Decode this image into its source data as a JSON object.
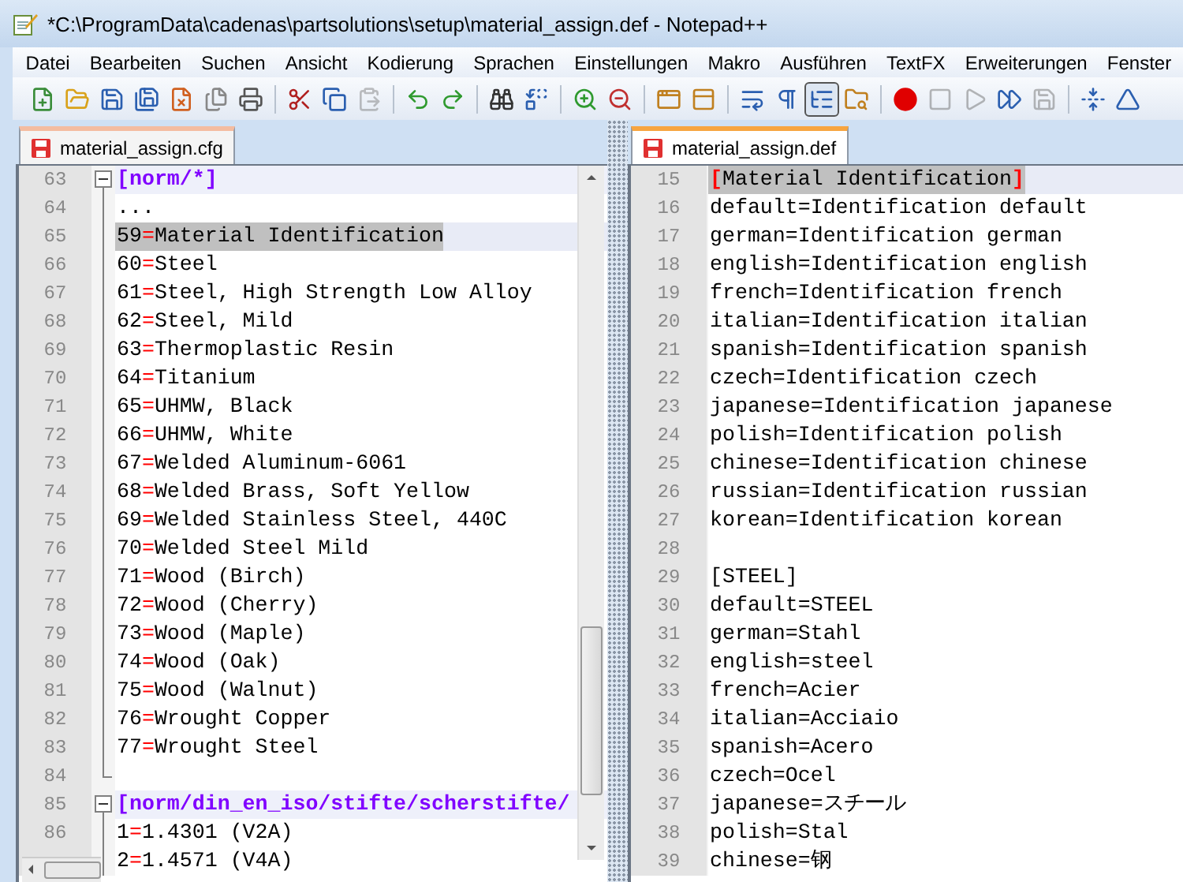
{
  "window": {
    "title": "*C:\\ProgramData\\cadenas\\partsolutions\\setup\\material_assign.def - Notepad++"
  },
  "menu": [
    "Datei",
    "Bearbeiten",
    "Suchen",
    "Ansicht",
    "Kodierung",
    "Sprachen",
    "Einstellungen",
    "Makro",
    "Ausführen",
    "TextFX",
    "Erweiterungen",
    "Fenster"
  ],
  "toolbar": [
    {
      "pressed": false,
      "disabled": false
    },
    {
      "pressed": false,
      "disabled": false
    },
    {
      "pressed": false,
      "disabled": false
    },
    {
      "pressed": false,
      "disabled": false
    },
    {
      "pressed": false,
      "disabled": false
    },
    {
      "pressed": false,
      "disabled": false
    },
    {
      "pressed": false,
      "disabled": false
    },
    {
      "pressed": false,
      "disabled": false
    },
    {
      "pressed": false,
      "disabled": false
    },
    {
      "pressed": false,
      "disabled": true
    },
    {
      "pressed": false,
      "disabled": false
    },
    {
      "pressed": false,
      "disabled": false
    },
    {
      "pressed": false,
      "disabled": false
    },
    {
      "pressed": false,
      "disabled": false
    },
    {
      "pressed": false,
      "disabled": false
    },
    {
      "pressed": false,
      "disabled": false
    },
    {
      "pressed": false,
      "disabled": false
    },
    {
      "pressed": false,
      "disabled": false
    },
    {
      "pressed": false,
      "disabled": false
    },
    {
      "pressed": false,
      "disabled": false
    },
    {
      "pressed": true,
      "disabled": false
    },
    {
      "pressed": false,
      "disabled": false
    },
    {
      "pressed": false,
      "disabled": false
    },
    {
      "pressed": false,
      "disabled": true
    },
    {
      "pressed": false,
      "disabled": true
    },
    {
      "pressed": false,
      "disabled": false
    },
    {
      "pressed": false,
      "disabled": true
    },
    {
      "pressed": false,
      "disabled": false
    },
    {
      "pressed": false,
      "disabled": false
    }
  ],
  "panes": [
    {
      "tab": {
        "label": "material_assign.cfg",
        "selected": false,
        "unsaved": true
      },
      "folding": true,
      "lines": [
        {
          "num": "63",
          "kind": "section",
          "text": "[norm/*]",
          "selected": false
        },
        {
          "num": "64",
          "kind": "plain",
          "text": "...",
          "selected": false
        },
        {
          "num": "65",
          "kind": "entry",
          "text": "59=Material Identification",
          "selected": true
        },
        {
          "num": "66",
          "kind": "entry",
          "text": "60=Steel",
          "selected": false
        },
        {
          "num": "67",
          "kind": "entry",
          "text": "61=Steel, High Strength Low Alloy",
          "selected": false
        },
        {
          "num": "68",
          "kind": "entry",
          "text": "62=Steel, Mild",
          "selected": false
        },
        {
          "num": "69",
          "kind": "entry",
          "text": "63=Thermoplastic Resin",
          "selected": false
        },
        {
          "num": "70",
          "kind": "entry",
          "text": "64=Titanium",
          "selected": false
        },
        {
          "num": "71",
          "kind": "entry",
          "text": "65=UHMW, Black",
          "selected": false
        },
        {
          "num": "72",
          "kind": "entry",
          "text": "66=UHMW, White",
          "selected": false
        },
        {
          "num": "73",
          "kind": "entry",
          "text": "67=Welded Aluminum-6061",
          "selected": false
        },
        {
          "num": "74",
          "kind": "entry",
          "text": "68=Welded Brass, Soft Yellow",
          "selected": false
        },
        {
          "num": "75",
          "kind": "entry",
          "text": "69=Welded Stainless Steel, 440C",
          "selected": false
        },
        {
          "num": "76",
          "kind": "entry",
          "text": "70=Welded Steel Mild",
          "selected": false
        },
        {
          "num": "77",
          "kind": "entry",
          "text": "71=Wood (Birch)",
          "selected": false
        },
        {
          "num": "78",
          "kind": "entry",
          "text": "72=Wood (Cherry)",
          "selected": false
        },
        {
          "num": "79",
          "kind": "entry",
          "text": "73=Wood (Maple)",
          "selected": false
        },
        {
          "num": "80",
          "kind": "entry",
          "text": "74=Wood (Oak)",
          "selected": false
        },
        {
          "num": "81",
          "kind": "entry",
          "text": "75=Wood (Walnut)",
          "selected": false
        },
        {
          "num": "82",
          "kind": "entry",
          "text": "76=Wrought Copper",
          "selected": false
        },
        {
          "num": "83",
          "kind": "entry",
          "text": "77=Wrought Steel",
          "selected": false
        },
        {
          "num": "84",
          "kind": "fold_end",
          "selected": false
        },
        {
          "num": "85",
          "kind": "section",
          "text": "[norm/din_en_iso/stifte/scherstifte/",
          "selected": false
        },
        {
          "num": "86",
          "kind": "entry",
          "text": "1=1.4301 (V2A)",
          "selected": false
        },
        {
          "kind": "entry",
          "text": "2=1.4571 (V4A)",
          "selected": false
        }
      ]
    },
    {
      "tab": {
        "label": "material_assign.def",
        "selected": true,
        "unsaved": true
      },
      "folding": false,
      "lines": [
        {
          "num": "15",
          "kind": "brace_match",
          "text": "[Material Identification]",
          "selected": true
        },
        {
          "num": "16",
          "kind": "plain",
          "text": "default=Identification default",
          "selected": false
        },
        {
          "num": "17",
          "kind": "plain",
          "text": "german=Identification german",
          "selected": false
        },
        {
          "num": "18",
          "kind": "plain",
          "text": "english=Identification english",
          "selected": false
        },
        {
          "num": "19",
          "kind": "plain",
          "text": "french=Identification french",
          "selected": false
        },
        {
          "num": "20",
          "kind": "plain",
          "text": "italian=Identification italian",
          "selected": false
        },
        {
          "num": "21",
          "kind": "plain",
          "text": "spanish=Identification spanish",
          "selected": false
        },
        {
          "num": "22",
          "kind": "plain",
          "text": "czech=Identification czech",
          "selected": false
        },
        {
          "num": "23",
          "kind": "plain",
          "text": "japanese=Identification japanese",
          "selected": false
        },
        {
          "num": "24",
          "kind": "plain",
          "text": "polish=Identification polish",
          "selected": false
        },
        {
          "num": "25",
          "kind": "plain",
          "text": "chinese=Identification chinese",
          "selected": false
        },
        {
          "num": "26",
          "kind": "plain",
          "text": "russian=Identification russian",
          "selected": false
        },
        {
          "num": "27",
          "kind": "plain",
          "text": "korean=Identification korean",
          "selected": false
        },
        {
          "num": "28",
          "kind": "plain",
          "selected": false
        },
        {
          "num": "29",
          "kind": "plain",
          "text": "[STEEL]",
          "selected": false
        },
        {
          "num": "30",
          "kind": "plain",
          "text": "default=STEEL",
          "selected": false
        },
        {
          "num": "31",
          "kind": "plain",
          "text": "german=Stahl",
          "selected": false
        },
        {
          "num": "32",
          "kind": "plain",
          "text": "english=steel",
          "selected": false
        },
        {
          "num": "33",
          "kind": "plain",
          "text": "french=Acier",
          "selected": false
        },
        {
          "num": "34",
          "kind": "plain",
          "text": "italian=Acciaio",
          "selected": false
        },
        {
          "num": "35",
          "kind": "plain",
          "text": "spanish=Acero",
          "selected": false
        },
        {
          "num": "36",
          "kind": "plain",
          "text": "czech=Ocel",
          "selected": false
        },
        {
          "num": "37",
          "kind": "plain",
          "text": "japanese=スチール",
          "selected": false
        },
        {
          "num": "38",
          "kind": "plain",
          "text": "polish=Stal",
          "selected": false
        },
        {
          "num": "39",
          "kind": "plain",
          "text": "chinese=钢",
          "selected": false
        }
      ]
    }
  ]
}
